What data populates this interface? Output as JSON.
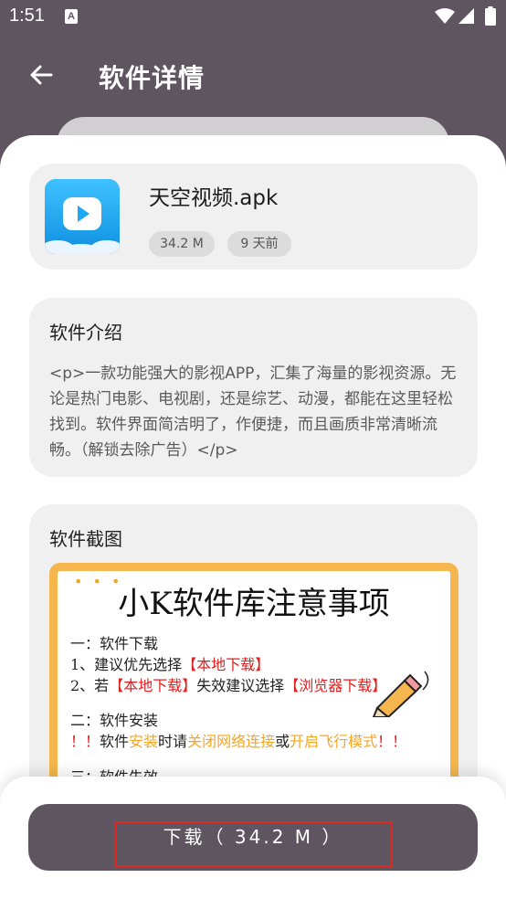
{
  "status_bar": {
    "time": "1:51",
    "icons": [
      "a-icon",
      "wifi-icon",
      "signal-icon",
      "battery-icon"
    ]
  },
  "app_bar": {
    "title": "软件详情",
    "back_icon": "arrow-left-icon"
  },
  "app": {
    "name": "天空视频.apk",
    "size": "34.2 M",
    "date": "9 天前",
    "icon_color": "#1ea7f2"
  },
  "intro": {
    "heading": "软件介绍",
    "text": "<p>一款功能强大的影视APP，汇集了海量的影视资源。无论是热门电影、电视剧，还是综艺、动漫，都能在这里轻松找到。软件界面简洁明了，作便捷，而且画质非常清晰流畅。（解锁去除广告）</p>"
  },
  "screenshots": {
    "heading": "软件截图",
    "image": {
      "dots": "• • •",
      "title": "小K软件库注意事项",
      "l1": "一：软件下载",
      "l2_a": "1、建议优先选择",
      "l2_b": "【本地下载】",
      "l3_a": "2、若",
      "l3_b": "【本地下载】",
      "l3_c": "失效建议选择",
      "l3_d": "【浏览器下载】",
      "l4": "二：软件安装",
      "l5_a": "！！",
      "l5_b": "软件",
      "l5_c": "安装",
      "l5_d": "时请",
      "l5_e": "关闭网络连接",
      "l5_f": "或",
      "l5_g": "开启飞行模式",
      "l5_h": "！！",
      "l6": "三：软件失效"
    }
  },
  "download": {
    "label": "下载（ 34.2 M ）"
  },
  "colors": {
    "primary": "#5f5560",
    "highlight": "#e0261e",
    "accent": "#f5b74d"
  }
}
